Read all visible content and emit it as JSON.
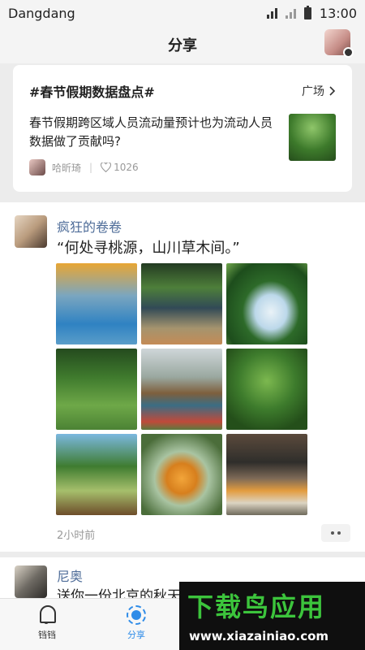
{
  "status_bar": {
    "carrier": "Dangdang",
    "time": "13:00"
  },
  "header": {
    "title": "分享"
  },
  "topic_card": {
    "hashtag": "#春节假期数据盘点#",
    "link_label": "广场",
    "text": "春节假期跨区域人员流动量预计也为流动人员数据做了贡献吗?",
    "author": "哈昕琦",
    "separator": "|",
    "likes": "1026"
  },
  "post": {
    "author": "疯狂的卷卷",
    "text": "“何处寻桃源，山川草木间。”",
    "time": "2小时前",
    "photos": [
      "photo-1",
      "photo-2",
      "photo-3",
      "photo-4",
      "photo-5",
      "photo-6",
      "photo-7",
      "photo-8",
      "photo-9"
    ]
  },
  "post2": {
    "author": "尼奥",
    "text": "送你一份北京的秋天"
  },
  "tabs": [
    {
      "label": "铛铛",
      "icon": "bell-icon",
      "active": false
    },
    {
      "label": "分享",
      "icon": "sun-icon",
      "active": true
    }
  ],
  "watermark": {
    "title": "下载鸟应用",
    "url": "www.xiazainiao.com"
  },
  "colors": {
    "accent": "#2f8ce8",
    "author_link": "#4f6d99",
    "watermark_green": "#3cc43c"
  }
}
